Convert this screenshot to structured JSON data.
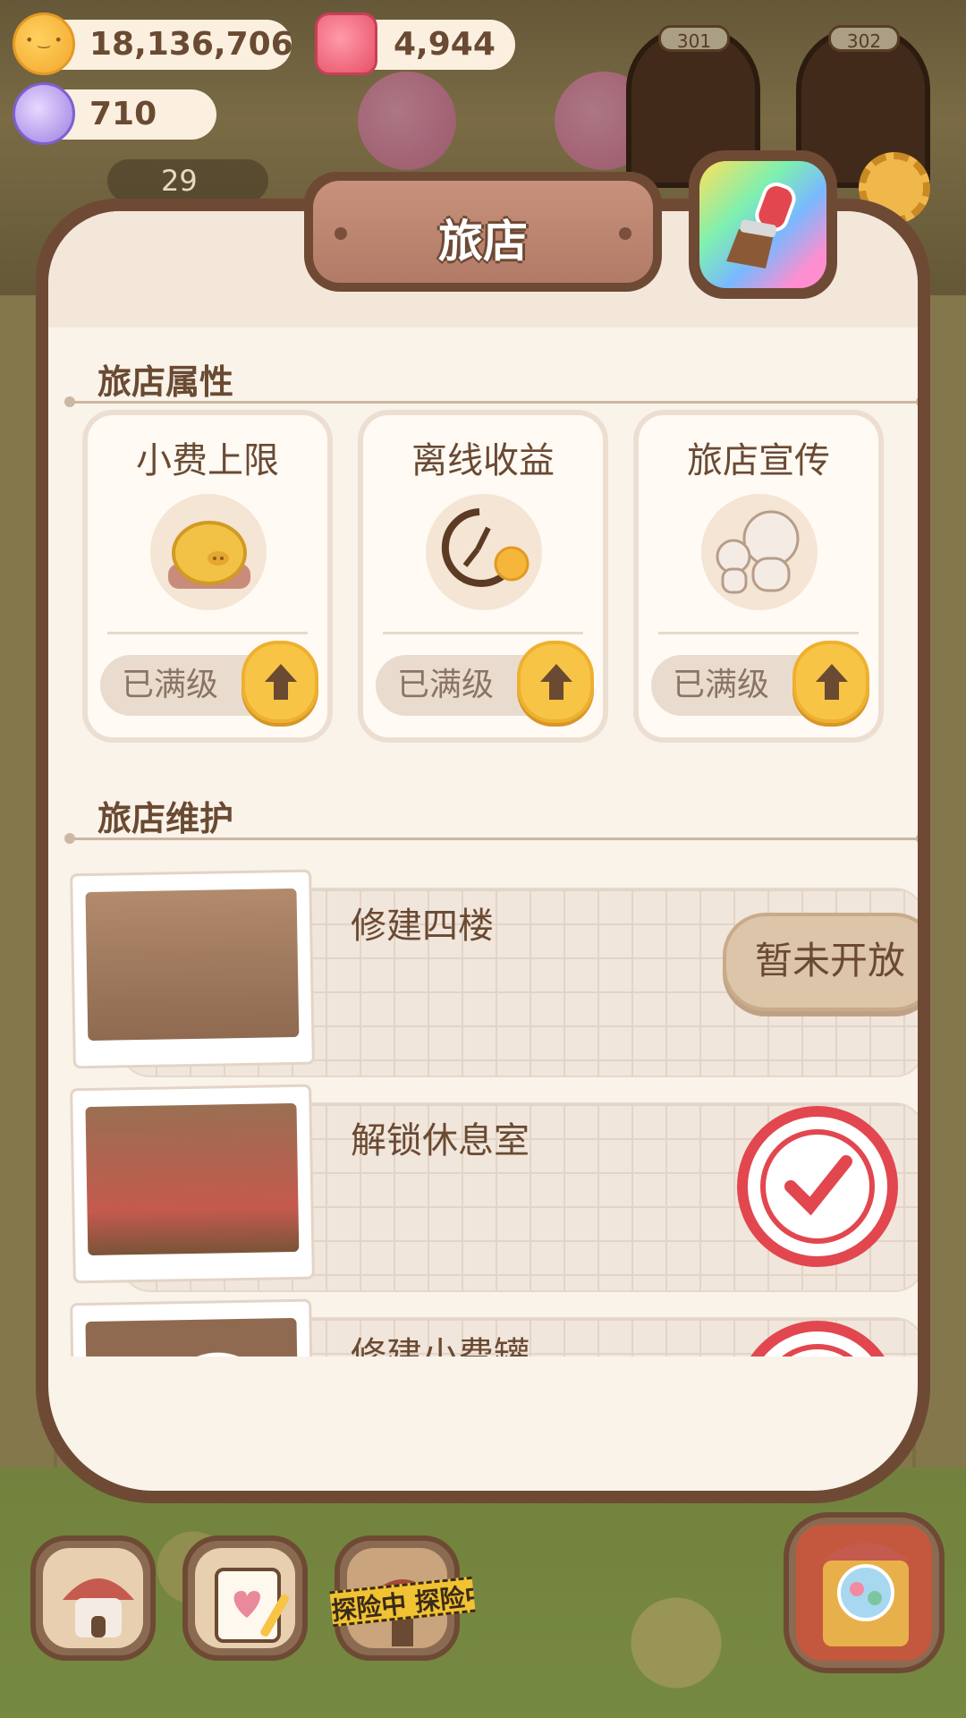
{
  "currency": {
    "cookies": "18,136,706",
    "gems": "4,944",
    "diamonds": "710",
    "staff_count": "29"
  },
  "background": {
    "rooms": [
      "301",
      "302"
    ]
  },
  "panel": {
    "title": "旅店",
    "attributes_section": "旅店属性",
    "maintenance_section": "旅店维护",
    "attributes": [
      {
        "label": "小费上限",
        "status": "已满级",
        "icon": "piggy-bank-icon"
      },
      {
        "label": "离线收益",
        "status": "已满级",
        "icon": "clock-cookie-icon"
      },
      {
        "label": "旅店宣传",
        "status": "已满级",
        "icon": "mascot-pair-icon"
      }
    ],
    "maintenance": [
      {
        "label": "修建四楼",
        "state": "locked",
        "button": "暂未开放"
      },
      {
        "label": "解锁休息室",
        "state": "done"
      },
      {
        "label": "修建小费罐",
        "state": "done"
      }
    ]
  },
  "bottom_nav": {
    "explore_tape": "探险中 探险中",
    "items": [
      "hotel-icon",
      "diary-icon",
      "explore-icon",
      "gacha-icon"
    ]
  },
  "colors": {
    "panel_border": "#6e4a35",
    "panel_fill": "#faf3ea",
    "accent_gold": "#f7c446",
    "stamp_red": "#e2474f"
  }
}
